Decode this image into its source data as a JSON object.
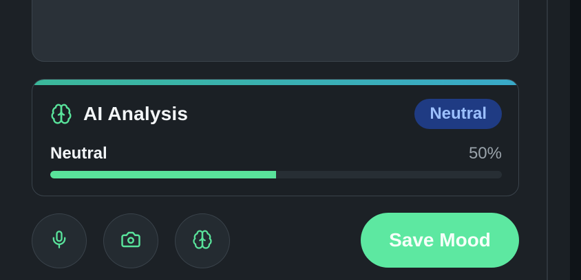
{
  "analysis": {
    "title": "AI Analysis",
    "badge": "Neutral",
    "metric_label": "Neutral",
    "metric_value": "50%",
    "progress_fraction": 0.5,
    "icon": "brain-icon"
  },
  "actions": {
    "buttons": [
      {
        "icon": "microphone-icon"
      },
      {
        "icon": "camera-icon"
      },
      {
        "icon": "brain-icon"
      }
    ],
    "save_label": "Save Mood"
  },
  "colors": {
    "accent_green": "#59e39b",
    "badge_bg": "#1f3b83",
    "badge_text": "#9cc0ff",
    "card_bg": "#1b2025"
  }
}
